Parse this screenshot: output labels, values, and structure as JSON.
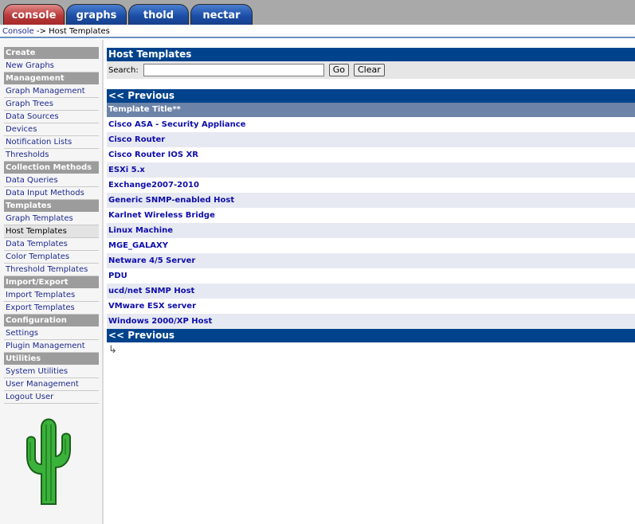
{
  "tabs": [
    {
      "label": "console"
    },
    {
      "label": "graphs"
    },
    {
      "label": "thold"
    },
    {
      "label": "nectar"
    }
  ],
  "breadcrumb": {
    "root": "Console",
    "separator": " -> ",
    "current": "Host Templates"
  },
  "sidebar": {
    "sections": [
      {
        "header": "Create",
        "items": [
          "New Graphs"
        ]
      },
      {
        "header": "Management",
        "items": [
          "Graph Management",
          "Graph Trees",
          "Data Sources",
          "Devices",
          "Notification Lists",
          "Thresholds"
        ]
      },
      {
        "header": "Collection Methods",
        "items": [
          "Data Queries",
          "Data Input Methods"
        ]
      },
      {
        "header": "Templates",
        "items": [
          "Graph Templates",
          "Host Templates",
          "Data Templates",
          "Color Templates",
          "Threshold Templates"
        ]
      },
      {
        "header": "Import/Export",
        "items": [
          "Import Templates",
          "Export Templates"
        ]
      },
      {
        "header": "Configuration",
        "items": [
          "Settings",
          "Plugin Management"
        ]
      },
      {
        "header": "Utilities",
        "items": [
          "System Utilities",
          "User Management",
          "Logout User"
        ]
      }
    ],
    "selected": "Host Templates"
  },
  "main": {
    "title": "Host Templates",
    "search": {
      "label": "Search:",
      "value": "",
      "go": "Go",
      "clear": "Clear"
    },
    "nav_previous": "<< Previous",
    "column_header": "Template Title**",
    "rows": [
      "Cisco ASA - Security Appliance",
      "Cisco Router",
      "Cisco Router IOS XR",
      "ESXi 5.x",
      "Exchange2007-2010",
      "Generic SNMP-enabled Host",
      "Karlnet Wireless Bridge",
      "Linux Machine",
      "MGE_GALAXY",
      "Netware 4/5 Server",
      "PDU",
      "ucd/net SNMP Host",
      "VMware ESX server",
      "Windows 2000/XP Host"
    ],
    "return_icon": "return-arrow-icon"
  },
  "colors": {
    "header_blue": "#00438c",
    "menu_header_gray": "#9c9c9c",
    "link_blue": "#1f2a8f",
    "active_tab_red": "#b83a3a"
  }
}
